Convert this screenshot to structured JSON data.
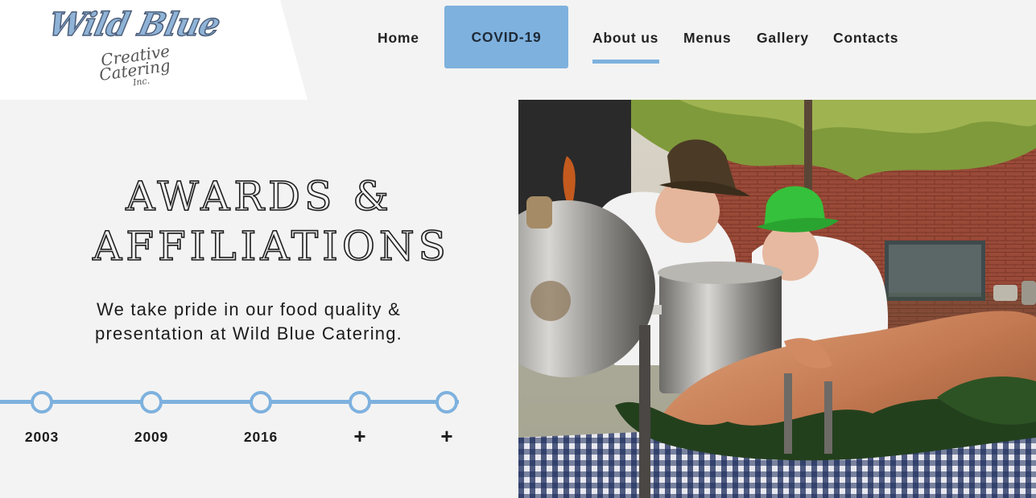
{
  "logo": {
    "main": "Wild Blue",
    "line1": "Creative",
    "line2": "Catering",
    "line3": "Inc."
  },
  "nav": {
    "home": "Home",
    "covid": "COVID-19",
    "about": "About us",
    "menus": "Menus",
    "gallery": "Gallery",
    "contacts": "Contacts",
    "active": "About us",
    "accent_color": "#7eb1de"
  },
  "hero": {
    "title_line1": "AWARDS &",
    "title_line2": "AFFILIATIONS",
    "tagline_line1": "We take pride in our food quality &",
    "tagline_line2": "presentation at Wild Blue Catering."
  },
  "timeline": {
    "items": [
      {
        "label": "2003"
      },
      {
        "label": "2009"
      },
      {
        "label": "2016"
      },
      {
        "label": "+"
      },
      {
        "label": "+"
      }
    ]
  },
  "photo": {
    "icon": "catering-chefs-photo"
  }
}
